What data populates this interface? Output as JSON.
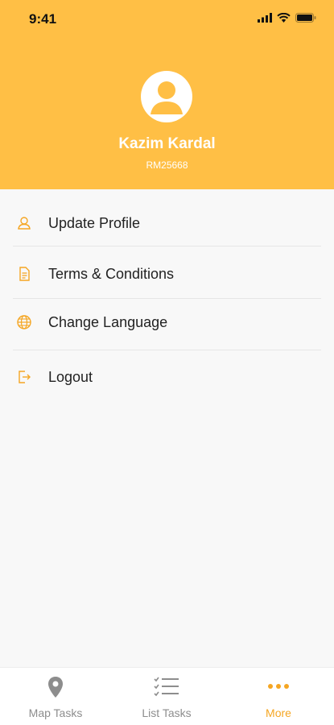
{
  "status_bar": {
    "time": "9:41"
  },
  "profile": {
    "name": "Kazim Kardal",
    "id": "RM25668"
  },
  "menu": {
    "items": [
      {
        "label": "Update Profile",
        "icon": "user-icon"
      },
      {
        "label": "Terms & Conditions",
        "icon": "document-icon"
      },
      {
        "label": "Change Language",
        "icon": "globe-icon"
      },
      {
        "label": "Logout",
        "icon": "logout-icon"
      }
    ]
  },
  "tabs": [
    {
      "label": "Map Tasks",
      "icon": "map-pin-icon",
      "active": false
    },
    {
      "label": "List Tasks",
      "icon": "checklist-icon",
      "active": false
    },
    {
      "label": "More",
      "icon": "more-dots-icon",
      "active": true
    }
  ],
  "colors": {
    "accent": "#ffbf45",
    "active_tab": "#f5a623",
    "inactive_tab": "#8d8d8d"
  }
}
